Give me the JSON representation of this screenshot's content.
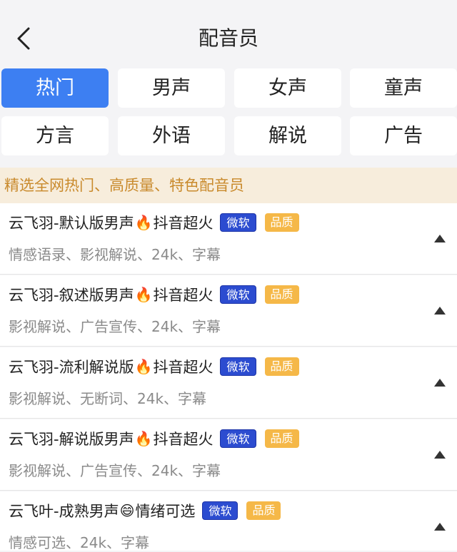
{
  "header": {
    "title": "配音员"
  },
  "tabs": [
    {
      "label": "热门",
      "active": true
    },
    {
      "label": "男声",
      "active": false
    },
    {
      "label": "女声",
      "active": false
    },
    {
      "label": "童声",
      "active": false
    },
    {
      "label": "方言",
      "active": false
    },
    {
      "label": "外语",
      "active": false
    },
    {
      "label": "解说",
      "active": false
    },
    {
      "label": "广告",
      "active": false
    }
  ],
  "banner": {
    "text": "精选全网热门、高质量、特色配音员"
  },
  "tags": {
    "microsoft": "微软",
    "quality": "品质"
  },
  "voices": [
    {
      "name_a": "云飞羽-默认版男声",
      "emoji": "🔥",
      "name_b": "抖音超火",
      "desc": "情感语录、影视解说、24k、字幕"
    },
    {
      "name_a": "云飞羽-叙述版男声",
      "emoji": "🔥",
      "name_b": "抖音超火",
      "desc": "影视解说、广告宣传、24k、字幕"
    },
    {
      "name_a": "云飞羽-流利解说版",
      "emoji": "🔥",
      "name_b": "抖音超火",
      "desc": "影视解说、无断词、24k、字幕"
    },
    {
      "name_a": "云飞羽-解说版男声",
      "emoji": "🔥",
      "name_b": "抖音超火",
      "desc": "影视解说、广告宣传、24k、字幕"
    },
    {
      "name_a": "云飞叶-成熟男声",
      "emoji": "😄",
      "name_b": "情绪可选",
      "desc": "情感可选、24k、字幕"
    }
  ],
  "colors": {
    "accent": "#3d7ff2",
    "banner_bg": "#f7eddc",
    "banner_text": "#c98a2c",
    "tag_ms": "#2c4cd0",
    "tag_pq": "#f5b848"
  }
}
